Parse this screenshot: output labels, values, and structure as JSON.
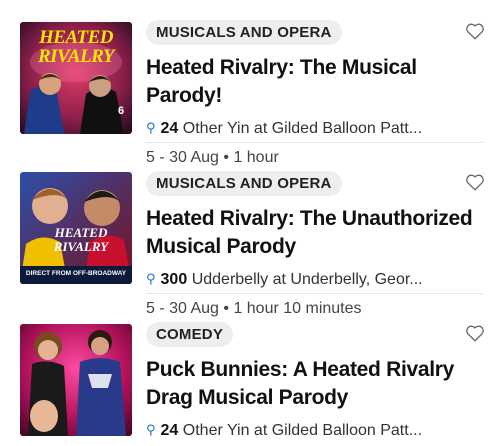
{
  "events": [
    {
      "category": "MUSICALS AND OPERA",
      "title": "Heated Rivalry: The Musical Parody!",
      "count": "24",
      "venue": "Other Yin  at Gilded Balloon Patt...",
      "dates": "5 - 30 Aug • 1 hour",
      "thumbnail_text": "HEATED RIVALRY",
      "favorite_icon": "heart-outline-icon",
      "location_icon": "map-pin-icon"
    },
    {
      "category": "MUSICALS AND OPERA",
      "title": "Heated Rivalry: The Unauthorized Musical Parody",
      "count": "300",
      "venue": "Udderbelly at Underbelly, Geor...",
      "dates": "5 - 30 Aug • 1 hour 10 minutes",
      "thumbnail_text": "HEATED RIVALRY",
      "thumbnail_caption": "DIRECT FROM OFF-BROADWAY",
      "favorite_icon": "heart-outline-icon",
      "location_icon": "map-pin-icon"
    },
    {
      "category": "COMEDY",
      "title": "Puck Bunnies: A Heated Rivalry Drag Musical Parody",
      "count": "24",
      "venue": "Other Yin  at Gilded Balloon Patt...",
      "favorite_icon": "heart-outline-icon",
      "location_icon": "map-pin-icon"
    }
  ],
  "colors": {
    "badge_bg": "#eeeeee",
    "pin": "#1a73c9",
    "text": "#111111"
  }
}
